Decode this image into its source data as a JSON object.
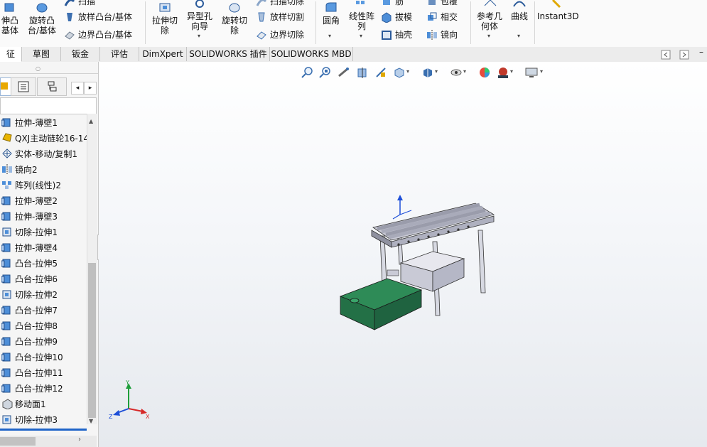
{
  "ribbon": {
    "extrude_boss_label": "伸凸\n基体",
    "revolve_boss_label": "旋转凸\n台/基体",
    "swept_boss_label": "扫描",
    "loft_boss_label": "放样凸台/基体",
    "boundary_boss_label": "边界凸台/基体",
    "extrude_cut_label": "拉伸切\n除",
    "hole_wizard_label": "异型孔\n向导",
    "revolve_cut_label": "旋转切\n除",
    "swept_cut_label": "扫描切除",
    "loft_cut_label": "放样切割",
    "boundary_cut_label": "边界切除",
    "fillet_label": "圆角",
    "linear_pattern_label": "线性阵\n列",
    "rib_label": "筋",
    "draft_label": "拔模",
    "shell_label": "抽壳",
    "wrap_label": "包覆",
    "intersect_label": "相交",
    "mirror_label": "镜向",
    "ref_geometry_label": "参考几\n何体",
    "curves_label": "曲线",
    "instant3d_label": "Instant3D"
  },
  "tabs": [
    {
      "label": "征"
    },
    {
      "label": "草图"
    },
    {
      "label": "钣金"
    },
    {
      "label": "评估"
    },
    {
      "label": "DimXpert"
    },
    {
      "label": "SOLIDWORKS 插件"
    },
    {
      "label": "SOLIDWORKS MBD"
    }
  ],
  "tree": [
    {
      "label": "拉伸-薄壁1",
      "icon": "extrude-icon"
    },
    {
      "label": "QXJ主动链轮16-14",
      "icon": "part-icon"
    },
    {
      "label": "实体-移动/复制1",
      "icon": "move-copy-icon"
    },
    {
      "label": "镜向2",
      "icon": "mirror-icon"
    },
    {
      "label": "阵列(线性)2",
      "icon": "linear-pattern-icon"
    },
    {
      "label": "拉伸-薄壁2",
      "icon": "extrude-icon"
    },
    {
      "label": "拉伸-薄壁3",
      "icon": "extrude-icon"
    },
    {
      "label": "切除-拉伸1",
      "icon": "cut-icon"
    },
    {
      "label": "拉伸-薄壁4",
      "icon": "extrude-icon"
    },
    {
      "label": "凸台-拉伸5",
      "icon": "extrude-icon"
    },
    {
      "label": "凸台-拉伸6",
      "icon": "extrude-icon"
    },
    {
      "label": "切除-拉伸2",
      "icon": "cut-icon"
    },
    {
      "label": "凸台-拉伸7",
      "icon": "extrude-icon"
    },
    {
      "label": "凸台-拉伸8",
      "icon": "extrude-icon"
    },
    {
      "label": "凸台-拉伸9",
      "icon": "extrude-icon"
    },
    {
      "label": "凸台-拉伸10",
      "icon": "extrude-icon"
    },
    {
      "label": "凸台-拉伸11",
      "icon": "extrude-icon"
    },
    {
      "label": "凸台-拉伸12",
      "icon": "extrude-icon"
    },
    {
      "label": "移动面1",
      "icon": "move-face-icon"
    },
    {
      "label": "切除-拉伸3",
      "icon": "cut-icon"
    }
  ],
  "triad": {
    "x": "X",
    "y": "Y",
    "z": "Z"
  },
  "colors": {
    "accent": "#1e64c8",
    "tank": "#2e8b57",
    "frame": "#c8c8d2"
  }
}
